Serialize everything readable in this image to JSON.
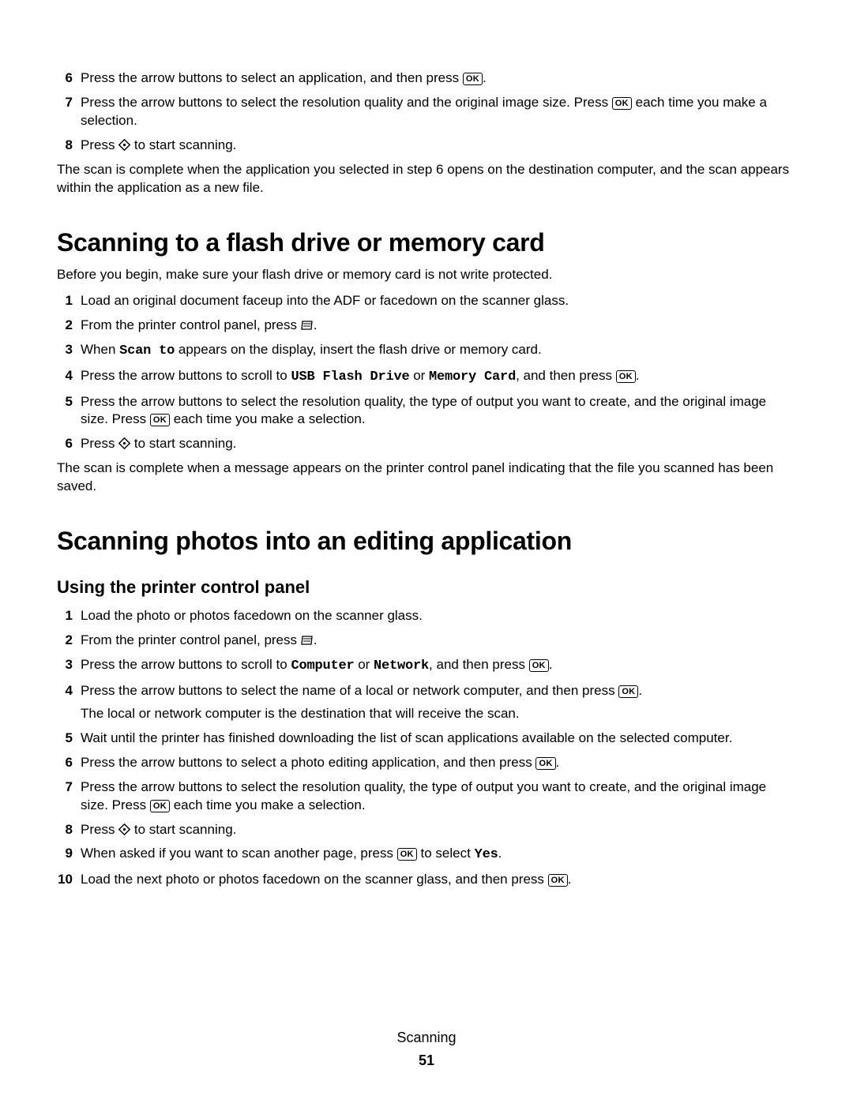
{
  "icons": {
    "ok_label": "OK"
  },
  "sec0": {
    "s6a": "Press the arrow buttons to select an application, and then press ",
    "s6b": ".",
    "s7a": "Press the arrow buttons to select the resolution quality and the original image size. Press ",
    "s7b": " each time you make a selection.",
    "s8a": "Press ",
    "s8b": " to start scanning.",
    "tail": "The scan is complete when the application you selected in step 6 opens on the destination computer, and the scan appears within the application as a new file."
  },
  "sec1": {
    "heading": "Scanning to a flash drive or memory card",
    "intro": "Before you begin, make sure your flash drive or memory card is not write protected.",
    "s1": "Load an original document faceup into the ADF or facedown on the scanner glass.",
    "s2a": "From the printer control panel, press ",
    "s2b": ".",
    "s3a": "When ",
    "s3_code": "Scan to",
    "s3b": " appears on the display, insert the flash drive or memory card.",
    "s4a": "Press the arrow buttons to scroll to ",
    "s4_code1": "USB Flash Drive",
    "s4_mid": " or ",
    "s4_code2": "Memory Card",
    "s4b": ", and then press ",
    "s4c": ".",
    "s5a": "Press the arrow buttons to select the resolution quality, the type of output you want to create, and the original image size. Press ",
    "s5b": " each time you make a selection.",
    "s6a": "Press ",
    "s6b": " to start scanning.",
    "tail": "The scan is complete when a message appears on the printer control panel indicating that the file you scanned has been saved."
  },
  "sec2": {
    "heading": "Scanning photos into an editing application",
    "sub": "Using the printer control panel",
    "s1": "Load the photo or photos facedown on the scanner glass.",
    "s2a": "From the printer control panel, press ",
    "s2b": ".",
    "s3a": "Press the arrow buttons to scroll to ",
    "s3_code1": "Computer",
    "s3_mid": " or ",
    "s3_code2": "Network",
    "s3b": ", and then press ",
    "s3c": ".",
    "s4a": "Press the arrow buttons to select the name of a local or network computer, and then press ",
    "s4b": ".",
    "s4_sub": "The local or network computer is the destination that will receive the scan.",
    "s5": "Wait until the printer has finished downloading the list of scan applications available on the selected computer.",
    "s6a": "Press the arrow buttons to select a photo editing application, and then press ",
    "s6b": ".",
    "s7a": "Press the arrow buttons to select the resolution quality, the type of output you want to create, and the original image size. Press ",
    "s7b": " each time you make a selection.",
    "s8a": "Press ",
    "s8b": " to start scanning.",
    "s9a": "When asked if you want to scan another page, press ",
    "s9b": " to select ",
    "s9_code": "Yes",
    "s9c": ".",
    "s10a": "Load the next photo or photos facedown on the scanner glass, and then press ",
    "s10b": "."
  },
  "footer": {
    "title": "Scanning",
    "page": "51"
  }
}
